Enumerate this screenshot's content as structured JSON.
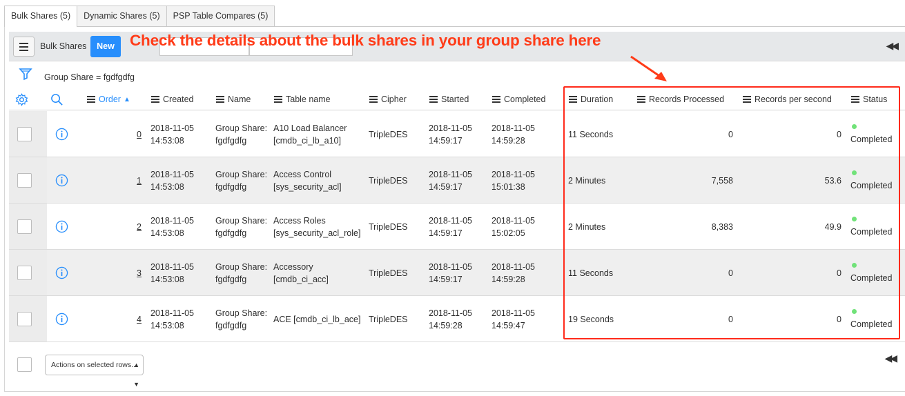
{
  "tabs": [
    {
      "label": "Bulk Shares (5)",
      "active": true
    },
    {
      "label": "Dynamic Shares (5)",
      "active": false
    },
    {
      "label": "PSP Table Compares (5)",
      "active": false
    }
  ],
  "header": {
    "list_title": "Bulk Shares",
    "new_label": "New",
    "collapse_icon": "double-left-arrow"
  },
  "annotation": "Check the details about the bulk shares in your group share here",
  "filter": {
    "text": "Group Share = fgdfgdfg",
    "icon": "funnel-icon"
  },
  "columns": {
    "order": "Order",
    "created": "Created",
    "name": "Name",
    "table_name": "Table name",
    "cipher": "Cipher",
    "started": "Started",
    "completed": "Completed",
    "duration": "Duration",
    "records_processed": "Records Processed",
    "records_per_second": "Records per second",
    "status": "Status"
  },
  "rows": [
    {
      "order": "0",
      "created_date": "2018-11-05",
      "created_time": "14:53:08",
      "name1": "Group Share:",
      "name2": "fgdfgdfg",
      "table1": "A10 Load Balancer",
      "table2": "[cmdb_ci_lb_a10]",
      "cipher": "TripleDES",
      "started_date": "2018-11-05",
      "started_time": "14:59:17",
      "completed_date": "2018-11-05",
      "completed_time": "14:59:28",
      "duration": "11 Seconds",
      "records": "0",
      "rps": "0",
      "status": "Completed"
    },
    {
      "order": "1",
      "created_date": "2018-11-05",
      "created_time": "14:53:08",
      "name1": "Group Share:",
      "name2": "fgdfgdfg",
      "table1": "Access Control",
      "table2": "[sys_security_acl]",
      "cipher": "TripleDES",
      "started_date": "2018-11-05",
      "started_time": "14:59:17",
      "completed_date": "2018-11-05",
      "completed_time": "15:01:38",
      "duration": "2 Minutes",
      "records": "7,558",
      "rps": "53.6",
      "status": "Completed"
    },
    {
      "order": "2",
      "created_date": "2018-11-05",
      "created_time": "14:53:08",
      "name1": "Group Share:",
      "name2": "fgdfgdfg",
      "table1": "Access Roles",
      "table2": "[sys_security_acl_role]",
      "cipher": "TripleDES",
      "started_date": "2018-11-05",
      "started_time": "14:59:17",
      "completed_date": "2018-11-05",
      "completed_time": "15:02:05",
      "duration": "2 Minutes",
      "records": "8,383",
      "rps": "49.9",
      "status": "Completed"
    },
    {
      "order": "3",
      "created_date": "2018-11-05",
      "created_time": "14:53:08",
      "name1": "Group Share:",
      "name2": "fgdfgdfg",
      "table1": "Accessory",
      "table2": "[cmdb_ci_acc]",
      "cipher": "TripleDES",
      "started_date": "2018-11-05",
      "started_time": "14:59:17",
      "completed_date": "2018-11-05",
      "completed_time": "14:59:28",
      "duration": "11 Seconds",
      "records": "0",
      "rps": "0",
      "status": "Completed"
    },
    {
      "order": "4",
      "created_date": "2018-11-05",
      "created_time": "14:53:08",
      "name1": "Group Share:",
      "name2": "fgdfgdfg",
      "table1": "ACE [cmdb_ci_lb_ace]",
      "table2": "",
      "cipher": "TripleDES",
      "started_date": "2018-11-05",
      "started_time": "14:59:28",
      "completed_date": "2018-11-05",
      "completed_time": "14:59:47",
      "duration": "19 Seconds",
      "records": "0",
      "rps": "0",
      "status": "Completed"
    }
  ],
  "footer": {
    "actions_label": "Actions on selected rows..."
  },
  "colors": {
    "accent": "#278efc",
    "annotation": "#ff3b18",
    "status_complete": "#71e279"
  }
}
